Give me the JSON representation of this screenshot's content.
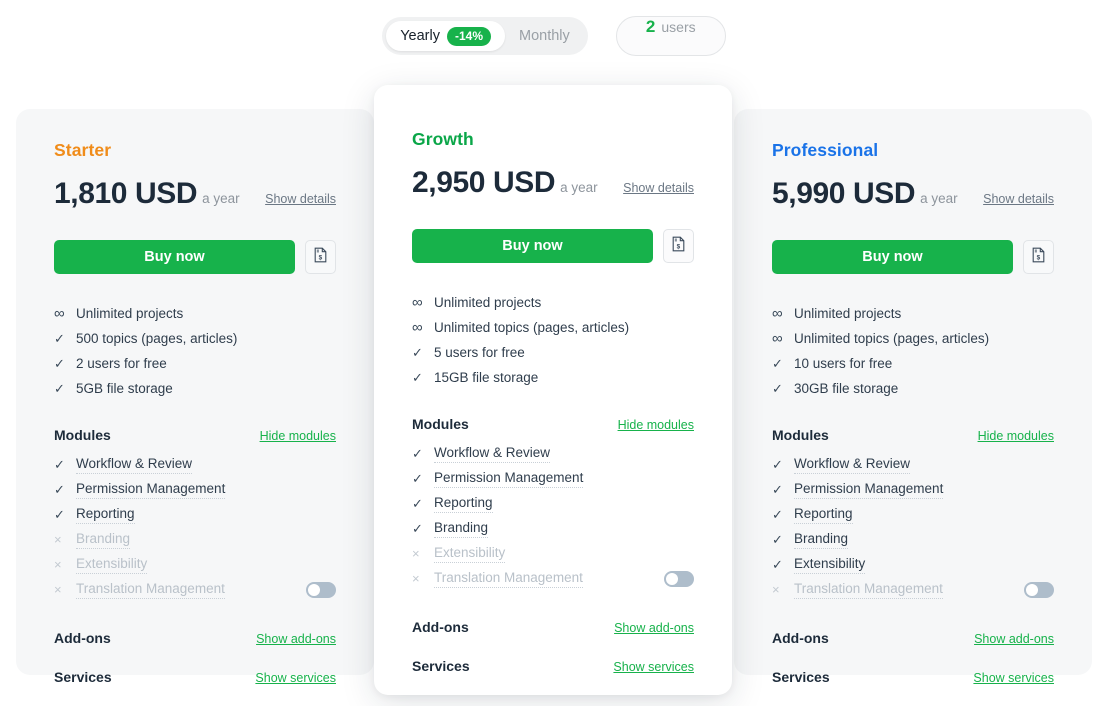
{
  "top_controls": {
    "billing": {
      "yearly_label": "Yearly",
      "discount_badge": "-14%",
      "monthly_label": "Monthly",
      "selected": "Yearly"
    },
    "users": {
      "count": "2",
      "label": "users"
    }
  },
  "common": {
    "show_details_label": "Show details",
    "buy_now_label": "Buy now",
    "quote_icon": "invoice-document-dollar-icon",
    "modules_title": "Modules",
    "hide_modules_label": "Hide modules",
    "addons_title": "Add-ons",
    "show_addons_label": "Show add-ons",
    "services_title": "Services",
    "show_services_label": "Show services",
    "check_mark": "✓",
    "cross_mark": "×",
    "infinity_mark": "∞"
  },
  "colors": {
    "starter_accent": "#f08c1a",
    "growth_accent": "#0aa648",
    "professional_accent": "#1a73e8",
    "buy_button": "#17b24b",
    "link_green": "#17b24b"
  },
  "plans": [
    {
      "name": "Starter",
      "accent": "#f08c1a",
      "price": "1,810 USD",
      "period": "a year",
      "features": [
        {
          "mark": "infinity",
          "text": "Unlimited projects"
        },
        {
          "mark": "check",
          "text": "500 topics (pages, articles)"
        },
        {
          "mark": "check",
          "text": "2 users for free"
        },
        {
          "mark": "check",
          "text": "5GB file storage"
        }
      ],
      "modules": [
        {
          "mark": "check",
          "text": "Workflow & Review",
          "enabled": true
        },
        {
          "mark": "check",
          "text": "Permission Management",
          "enabled": true
        },
        {
          "mark": "check",
          "text": "Reporting",
          "enabled": true
        },
        {
          "mark": "cross",
          "text": "Branding",
          "enabled": false
        },
        {
          "mark": "cross",
          "text": "Extensibility",
          "enabled": false
        },
        {
          "mark": "cross",
          "text": "Translation Management",
          "enabled": false,
          "toggle": "off"
        }
      ]
    },
    {
      "name": "Growth",
      "accent": "#0aa648",
      "price": "2,950 USD",
      "period": "a year",
      "features": [
        {
          "mark": "infinity",
          "text": "Unlimited projects"
        },
        {
          "mark": "infinity",
          "text": "Unlimited topics (pages, articles)"
        },
        {
          "mark": "check",
          "text": "5 users for free"
        },
        {
          "mark": "check",
          "text": "15GB file storage"
        }
      ],
      "modules": [
        {
          "mark": "check",
          "text": "Workflow & Review",
          "enabled": true
        },
        {
          "mark": "check",
          "text": "Permission Management",
          "enabled": true
        },
        {
          "mark": "check",
          "text": "Reporting",
          "enabled": true
        },
        {
          "mark": "check",
          "text": "Branding",
          "enabled": true
        },
        {
          "mark": "cross",
          "text": "Extensibility",
          "enabled": false
        },
        {
          "mark": "cross",
          "text": "Translation Management",
          "enabled": false,
          "toggle": "off"
        }
      ]
    },
    {
      "name": "Professional",
      "accent": "#1a73e8",
      "price": "5,990 USD",
      "period": "a year",
      "features": [
        {
          "mark": "infinity",
          "text": "Unlimited projects"
        },
        {
          "mark": "infinity",
          "text": "Unlimited topics (pages, articles)"
        },
        {
          "mark": "check",
          "text": "10 users for free"
        },
        {
          "mark": "check",
          "text": "30GB file storage"
        }
      ],
      "modules": [
        {
          "mark": "check",
          "text": "Workflow & Review",
          "enabled": true
        },
        {
          "mark": "check",
          "text": "Permission Management",
          "enabled": true
        },
        {
          "mark": "check",
          "text": "Reporting",
          "enabled": true
        },
        {
          "mark": "check",
          "text": "Branding",
          "enabled": true
        },
        {
          "mark": "check",
          "text": "Extensibility",
          "enabled": true
        },
        {
          "mark": "cross",
          "text": "Translation Management",
          "enabled": false,
          "toggle": "off"
        }
      ]
    }
  ]
}
